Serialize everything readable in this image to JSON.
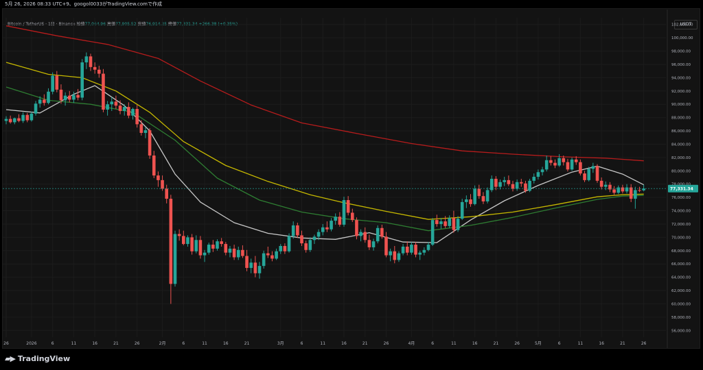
{
  "header": {
    "text": "5月 26, 2026 08:33 UTC+9、googol0033がTradingView.comで作成"
  },
  "legend": {
    "symbol": "Bitcoin / TetherUS · 1日 · Binance",
    "open_label": "始値",
    "open": "77,064.96",
    "high_label": "高値",
    "high": "77,905.52",
    "low_label": "安値",
    "low": "76,914.25",
    "close_label": "終値",
    "close": "77,331.34",
    "change": "+266.38 (+0.35%)"
  },
  "currency_button": "USDT",
  "last_price_label": "77,331.34",
  "brand": {
    "name": "TradingView",
    "logo_icon": "tradingview-logo-icon"
  },
  "colors": {
    "up": "#26a69a",
    "down": "#ef5350",
    "ma_white": "#c8c8c8",
    "ma_yellow": "#c6b800",
    "ma_green": "#2e7d32",
    "ma_red": "#b71c1c",
    "background": "#131313"
  },
  "chart_data": {
    "type": "candlestick",
    "ylim": [
      55000,
      103000
    ],
    "y_ticks": [
      56000,
      58000,
      60000,
      62000,
      64000,
      66000,
      68000,
      70000,
      72000,
      74000,
      76000,
      78000,
      80000,
      82000,
      84000,
      86000,
      88000,
      90000,
      92000,
      94000,
      96000,
      98000,
      100000,
      102000
    ],
    "y_tick_labels": [
      "56,000.00",
      "58,000.00",
      "60,000.00",
      "62,000.00",
      "64,000.00",
      "66,000.00",
      "68,000.00",
      "70,000.00",
      "72,000.00",
      "74,000.00",
      "76,000.00",
      "78,000.00",
      "80,000.00",
      "82,000.00",
      "84,000.00",
      "86,000.00",
      "88,000.00",
      "90,000.00",
      "92,000.00",
      "94,000.00",
      "96,000.00",
      "98,000.00",
      "100,000.00",
      "102,000.00"
    ],
    "x_tick_labels": [
      {
        "label": "26",
        "index": 0
      },
      {
        "label": "2026",
        "index": 6
      },
      {
        "label": "6",
        "index": 11
      },
      {
        "label": "11",
        "index": 16
      },
      {
        "label": "16",
        "index": 21
      },
      {
        "label": "21",
        "index": 26
      },
      {
        "label": "26",
        "index": 31
      },
      {
        "label": "2月",
        "index": 37
      },
      {
        "label": "6",
        "index": 42
      },
      {
        "label": "11",
        "index": 47
      },
      {
        "label": "16",
        "index": 52
      },
      {
        "label": "21",
        "index": 57
      },
      {
        "label": "3月",
        "index": 65
      },
      {
        "label": "6",
        "index": 70
      },
      {
        "label": "11",
        "index": 75
      },
      {
        "label": "16",
        "index": 80
      },
      {
        "label": "21",
        "index": 85
      },
      {
        "label": "26",
        "index": 90
      },
      {
        "label": "4月",
        "index": 96
      },
      {
        "label": "6",
        "index": 101
      },
      {
        "label": "11",
        "index": 106
      },
      {
        "label": "16",
        "index": 111
      },
      {
        "label": "21",
        "index": 116
      },
      {
        "label": "26",
        "index": 121
      },
      {
        "label": "5月",
        "index": 126
      },
      {
        "label": "6",
        "index": 131
      },
      {
        "label": "11",
        "index": 136
      },
      {
        "label": "16",
        "index": 141
      },
      {
        "label": "21",
        "index": 146
      },
      {
        "label": "26",
        "index": 151
      }
    ],
    "candles": [
      [
        87500,
        88200,
        87000,
        87800
      ],
      [
        87800,
        88300,
        87100,
        87300
      ],
      [
        87300,
        88000,
        87000,
        87900
      ],
      [
        87900,
        88500,
        87300,
        87500
      ],
      [
        87500,
        88800,
        87200,
        88400
      ],
      [
        88400,
        88700,
        87300,
        87600
      ],
      [
        87600,
        88900,
        87400,
        88600
      ],
      [
        88600,
        90500,
        88300,
        90100
      ],
      [
        90100,
        91200,
        89500,
        90700
      ],
      [
        90700,
        91500,
        89800,
        90200
      ],
      [
        90200,
        92400,
        90000,
        91900
      ],
      [
        91900,
        94800,
        91500,
        94300
      ],
      [
        94300,
        95000,
        91800,
        92200
      ],
      [
        92200,
        93000,
        90100,
        90600
      ],
      [
        90600,
        91800,
        89800,
        91300
      ],
      [
        91300,
        92000,
        90300,
        90700
      ],
      [
        90700,
        91900,
        90200,
        91400
      ],
      [
        91400,
        92300,
        90600,
        91000
      ],
      [
        91000,
        96800,
        90600,
        96300
      ],
      [
        96300,
        97800,
        95300,
        97200
      ],
      [
        97200,
        97600,
        95000,
        95600
      ],
      [
        95600,
        96300,
        94600,
        95200
      ],
      [
        95200,
        95800,
        94000,
        94600
      ],
      [
        94600,
        95300,
        88800,
        89200
      ],
      [
        89200,
        90500,
        88300,
        90000
      ],
      [
        90000,
        91100,
        89000,
        90400
      ],
      [
        90400,
        91300,
        89300,
        89800
      ],
      [
        89800,
        90600,
        88500,
        89000
      ],
      [
        89000,
        90000,
        88300,
        89600
      ],
      [
        89600,
        90300,
        87900,
        88300
      ],
      [
        88300,
        89500,
        87700,
        89300
      ],
      [
        89300,
        89900,
        86500,
        87000
      ],
      [
        87000,
        87600,
        85300,
        85700
      ],
      [
        85700,
        86600,
        84900,
        86100
      ],
      [
        86100,
        86400,
        81800,
        82300
      ],
      [
        82300,
        83000,
        78900,
        79300
      ],
      [
        79300,
        79900,
        77600,
        78600
      ],
      [
        78600,
        79300,
        77000,
        77300
      ],
      [
        77300,
        77900,
        75100,
        75800
      ],
      [
        75800,
        76400,
        60000,
        63000
      ],
      [
        63000,
        71000,
        62600,
        70500
      ],
      [
        70500,
        71200,
        69500,
        70200
      ],
      [
        70200,
        71000,
        68800,
        69000
      ],
      [
        69000,
        70300,
        68600,
        70000
      ],
      [
        70000,
        70500,
        67400,
        67900
      ],
      [
        67900,
        70300,
        67600,
        69600
      ],
      [
        69600,
        70200,
        66800,
        67300
      ],
      [
        67300,
        68100,
        66300,
        67700
      ],
      [
        67700,
        69200,
        67400,
        68900
      ],
      [
        68900,
        69600,
        67800,
        68300
      ],
      [
        68300,
        69700,
        68000,
        69400
      ],
      [
        69400,
        69900,
        68600,
        69000
      ],
      [
        69000,
        69300,
        67300,
        67700
      ],
      [
        67700,
        68700,
        67000,
        68300
      ],
      [
        68300,
        68900,
        66600,
        67000
      ],
      [
        67000,
        68600,
        66600,
        68100
      ],
      [
        68100,
        68800,
        66900,
        67200
      ],
      [
        67200,
        68100,
        64900,
        65400
      ],
      [
        65400,
        66800,
        64600,
        66200
      ],
      [
        66200,
        67200,
        64000,
        64600
      ],
      [
        64600,
        66300,
        63800,
        65700
      ],
      [
        65700,
        68000,
        65300,
        67600
      ],
      [
        67600,
        68600,
        66900,
        67300
      ],
      [
        67300,
        67900,
        66400,
        66800
      ],
      [
        66800,
        68300,
        66600,
        67900
      ],
      [
        67900,
        69000,
        67500,
        68700
      ],
      [
        68700,
        69100,
        67500,
        67900
      ],
      [
        67900,
        70600,
        67700,
        70200
      ],
      [
        70200,
        72400,
        69800,
        71800
      ],
      [
        71800,
        72200,
        69900,
        70300
      ],
      [
        70300,
        71000,
        68700,
        69100
      ],
      [
        69100,
        69500,
        67700,
        68100
      ],
      [
        68100,
        70000,
        67800,
        69600
      ],
      [
        69600,
        70400,
        69000,
        70100
      ],
      [
        70100,
        71200,
        69600,
        70800
      ],
      [
        70800,
        72000,
        70300,
        71500
      ],
      [
        71500,
        72400,
        70800,
        71200
      ],
      [
        71200,
        72900,
        70900,
        72500
      ],
      [
        72500,
        73600,
        71900,
        73100
      ],
      [
        73100,
        73800,
        71600,
        71900
      ],
      [
        71900,
        76100,
        71600,
        75600
      ],
      [
        75600,
        76200,
        73300,
        73700
      ],
      [
        73700,
        74300,
        72300,
        72600
      ],
      [
        72600,
        73000,
        69700,
        70200
      ],
      [
        70200,
        71200,
        69400,
        70800
      ],
      [
        70800,
        71500,
        69200,
        69600
      ],
      [
        69600,
        70400,
        68100,
        68500
      ],
      [
        68500,
        69800,
        68000,
        69400
      ],
      [
        69400,
        71800,
        69100,
        71400
      ],
      [
        71400,
        71900,
        69800,
        70100
      ],
      [
        70100,
        70800,
        67000,
        67300
      ],
      [
        67300,
        68300,
        66400,
        67900
      ],
      [
        67900,
        68700,
        66100,
        66600
      ],
      [
        66600,
        67900,
        66300,
        67600
      ],
      [
        67600,
        69000,
        67300,
        68600
      ],
      [
        68600,
        69400,
        67300,
        67700
      ],
      [
        67700,
        69300,
        67400,
        68900
      ],
      [
        68900,
        69300,
        67000,
        67400
      ],
      [
        67400,
        68000,
        66600,
        67700
      ],
      [
        67700,
        68500,
        67300,
        68100
      ],
      [
        68100,
        69300,
        67900,
        68900
      ],
      [
        68900,
        72900,
        68700,
        72600
      ],
      [
        72600,
        73400,
        71600,
        72000
      ],
      [
        72000,
        72900,
        71300,
        72400
      ],
      [
        72400,
        73200,
        71400,
        71700
      ],
      [
        71700,
        73300,
        71400,
        72900
      ],
      [
        72900,
        74000,
        70700,
        71100
      ],
      [
        71100,
        73200,
        70800,
        72800
      ],
      [
        72800,
        75800,
        72600,
        75300
      ],
      [
        75300,
        76300,
        74400,
        75700
      ],
      [
        75700,
        76500,
        74600,
        75000
      ],
      [
        75000,
        77800,
        74800,
        77300
      ],
      [
        77300,
        77900,
        75800,
        76200
      ],
      [
        76200,
        76800,
        75000,
        75400
      ],
      [
        75400,
        77500,
        75100,
        77100
      ],
      [
        77100,
        79300,
        76800,
        78800
      ],
      [
        78800,
        79200,
        77100,
        77600
      ],
      [
        77600,
        78700,
        77200,
        78300
      ],
      [
        78300,
        79100,
        77700,
        78600
      ],
      [
        78600,
        79300,
        77700,
        78000
      ],
      [
        78000,
        78500,
        76900,
        77300
      ],
      [
        77300,
        78700,
        77000,
        78300
      ],
      [
        78300,
        78800,
        77600,
        78100
      ],
      [
        78100,
        78500,
        76700,
        77000
      ],
      [
        77000,
        78800,
        76800,
        78500
      ],
      [
        78500,
        79600,
        78100,
        79100
      ],
      [
        79100,
        80200,
        78700,
        79800
      ],
      [
        79800,
        80600,
        79300,
        80200
      ],
      [
        80200,
        82300,
        79900,
        81600
      ],
      [
        81600,
        82200,
        80800,
        81200
      ],
      [
        81200,
        81700,
        80400,
        80800
      ],
      [
        80800,
        82500,
        80600,
        81900
      ],
      [
        81900,
        82300,
        80800,
        81300
      ],
      [
        81300,
        81800,
        79900,
        80200
      ],
      [
        80200,
        82000,
        80000,
        81700
      ],
      [
        81700,
        82200,
        80900,
        81300
      ],
      [
        81300,
        81700,
        79300,
        79600
      ],
      [
        79600,
        80000,
        78300,
        78600
      ],
      [
        78600,
        80600,
        78400,
        80300
      ],
      [
        80300,
        81200,
        79700,
        80700
      ],
      [
        80700,
        81000,
        78200,
        78500
      ],
      [
        78500,
        79000,
        77200,
        77600
      ],
      [
        77600,
        78400,
        77100,
        77900
      ],
      [
        77900,
        78300,
        76800,
        77200
      ],
      [
        77200,
        77700,
        76400,
        76700
      ],
      [
        76700,
        77800,
        76500,
        77500
      ],
      [
        77500,
        77900,
        76600,
        76900
      ],
      [
        76900,
        78000,
        76600,
        77500
      ],
      [
        77500,
        78000,
        75300,
        75800
      ],
      [
        75800,
        77600,
        74300,
        77100
      ],
      [
        77100,
        77600,
        76800,
        77064
      ],
      [
        77064,
        77905,
        76914,
        77331
      ]
    ],
    "moving_averages": [
      {
        "color": "#c8c8c8",
        "values": [
          [
            0,
            89200
          ],
          [
            8,
            88700
          ],
          [
            16,
            91500
          ],
          [
            21,
            92800
          ],
          [
            28,
            89800
          ],
          [
            34,
            86000
          ],
          [
            40,
            79500
          ],
          [
            46,
            75300
          ],
          [
            54,
            72200
          ],
          [
            62,
            70600
          ],
          [
            70,
            69900
          ],
          [
            78,
            69700
          ],
          [
            86,
            70700
          ],
          [
            94,
            69300
          ],
          [
            102,
            69200
          ],
          [
            110,
            72600
          ],
          [
            118,
            75500
          ],
          [
            126,
            77800
          ],
          [
            134,
            79800
          ],
          [
            140,
            80700
          ],
          [
            146,
            79500
          ],
          [
            151,
            77900
          ]
        ]
      },
      {
        "color": "#c6b800",
        "values": [
          [
            0,
            96300
          ],
          [
            10,
            94500
          ],
          [
            18,
            94000
          ],
          [
            26,
            92000
          ],
          [
            34,
            88800
          ],
          [
            42,
            84400
          ],
          [
            52,
            80800
          ],
          [
            62,
            78400
          ],
          [
            72,
            76400
          ],
          [
            80,
            75200
          ],
          [
            90,
            73900
          ],
          [
            100,
            72700
          ],
          [
            110,
            73100
          ],
          [
            120,
            73800
          ],
          [
            130,
            74900
          ],
          [
            140,
            76100
          ],
          [
            146,
            76400
          ],
          [
            151,
            76500
          ]
        ]
      },
      {
        "color": "#2e7d32",
        "values": [
          [
            0,
            92600
          ],
          [
            10,
            90600
          ],
          [
            20,
            90000
          ],
          [
            30,
            88800
          ],
          [
            40,
            84600
          ],
          [
            50,
            78900
          ],
          [
            60,
            75600
          ],
          [
            70,
            73800
          ],
          [
            80,
            72800
          ],
          [
            90,
            72200
          ],
          [
            100,
            71000
          ],
          [
            110,
            71800
          ],
          [
            120,
            73000
          ],
          [
            130,
            74400
          ],
          [
            140,
            75700
          ],
          [
            146,
            76200
          ],
          [
            151,
            76300
          ]
        ]
      },
      {
        "color": "#b71c1c",
        "values": [
          [
            0,
            101800
          ],
          [
            12,
            100300
          ],
          [
            24,
            99000
          ],
          [
            36,
            96900
          ],
          [
            46,
            93500
          ],
          [
            58,
            89900
          ],
          [
            70,
            87200
          ],
          [
            84,
            85500
          ],
          [
            96,
            84100
          ],
          [
            108,
            83000
          ],
          [
            120,
            82500
          ],
          [
            132,
            82100
          ],
          [
            142,
            81900
          ],
          [
            151,
            81500
          ]
        ]
      }
    ]
  }
}
